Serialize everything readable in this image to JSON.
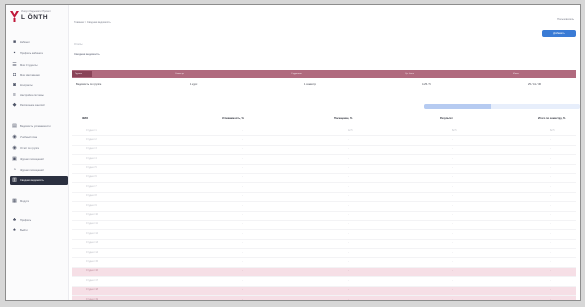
{
  "colors": {
    "accent": "#3a7bd5",
    "brand": "#c0183a",
    "summary_bar": "#b06a7e",
    "highlight_row": "#f6dfe6",
    "sidebar_active": "#2b3040"
  },
  "brand": {
    "subtitle": "Ушкул Хадымати Проект",
    "name": "L ÖNTH"
  },
  "sidebar": {
    "items": [
      {
        "icon": "home-icon",
        "label": "Кабинет"
      },
      {
        "icon": "chart-icon",
        "label": "Профиль кабинета"
      },
      {
        "icon": "users-icon",
        "label": "Мои Студенты"
      },
      {
        "icon": "doc-icon",
        "label": "Мои Наставники"
      },
      {
        "icon": "list-icon",
        "label": "Контракты"
      },
      {
        "icon": "settings-icon",
        "label": "Настройка системы"
      },
      {
        "icon": "calendar-icon",
        "label": "Расписание занятий"
      },
      {
        "icon": "book-icon",
        "label": "Ведомость успеваемости"
      },
      {
        "icon": "file-icon",
        "label": "Учебный план"
      },
      {
        "icon": "table-icon",
        "label": "Отчёт по группе"
      },
      {
        "icon": "clock-icon",
        "label": "Журнал посещений"
      },
      {
        "icon": "report-icon",
        "label": "Сводная ведомость"
      },
      {
        "icon": "grid-icon",
        "label": "Модули"
      },
      {
        "icon": "user-icon",
        "label": "Профиль"
      },
      {
        "icon": "logout-icon",
        "label": "Выйти"
      }
    ]
  },
  "header": {
    "breadcrumb": "Главная > Сводная ведомость",
    "user": "Пользователь",
    "primary_button": "Добавить"
  },
  "page": {
    "crumb": "Отчёты",
    "title": "Сводная ведомость"
  },
  "summary": {
    "headers": [
      "Группа",
      "Семестр",
      "Студентов",
      "Ср. балл",
      "Итого"
    ],
    "values": [
      "Ведомость по группе",
      "1 курс",
      "1 семестр",
      "4.25 / 5",
      "25 / 41 / 36"
    ]
  },
  "progress": {
    "percent": 43
  },
  "table": {
    "headers": [
      "ФИО",
      "Успеваемость, %",
      "Посещение, %",
      "Результат",
      "Итого по семестру, %"
    ],
    "rows": [
      {
        "cells": [
          "Студент 1",
          "-",
          "12.5",
          "62.5",
          "62.5"
        ],
        "highlight": false
      },
      {
        "cells": [
          "Студент 2",
          "-",
          "-",
          "-",
          "-"
        ],
        "highlight": false
      },
      {
        "cells": [
          "Студент 3",
          "-",
          "-",
          "-",
          "-"
        ],
        "highlight": false
      },
      {
        "cells": [
          "Студент 4",
          "-",
          "-",
          "-",
          "-"
        ],
        "highlight": false
      },
      {
        "cells": [
          "Студент 5",
          "-",
          "-",
          "-",
          "-"
        ],
        "highlight": false
      },
      {
        "cells": [
          "Студент 6",
          "-",
          "-",
          "-",
          "-"
        ],
        "highlight": false
      },
      {
        "cells": [
          "Студент 7",
          "-",
          "-",
          "-",
          "-"
        ],
        "highlight": false
      },
      {
        "cells": [
          "Студент 8",
          "-",
          "-",
          "-",
          "-"
        ],
        "highlight": false
      },
      {
        "cells": [
          "Студент 9",
          "-",
          "-",
          "-",
          "-"
        ],
        "highlight": false
      },
      {
        "cells": [
          "Студент 10",
          "-",
          "-",
          "-",
          "-"
        ],
        "highlight": false
      },
      {
        "cells": [
          "Студент 11",
          "-",
          "-",
          "-",
          "-"
        ],
        "highlight": false
      },
      {
        "cells": [
          "Студент 12",
          "-",
          "-",
          "-",
          "-"
        ],
        "highlight": false
      },
      {
        "cells": [
          "Студент 13",
          "-",
          "-",
          "-",
          "-"
        ],
        "highlight": false
      },
      {
        "cells": [
          "Студент 14",
          "-",
          "-",
          "-",
          "-"
        ],
        "highlight": false
      },
      {
        "cells": [
          "Студент 15",
          "-",
          "-",
          "-",
          "-"
        ],
        "highlight": false
      },
      {
        "cells": [
          "Студент 16",
          "-",
          "-",
          "-",
          "-"
        ],
        "highlight": true
      },
      {
        "cells": [
          "Студент 17",
          "-",
          "-",
          "-",
          "-"
        ],
        "highlight": false
      },
      {
        "cells": [
          "Студент 18",
          "-",
          "-",
          "-",
          "-"
        ],
        "highlight": true
      },
      {
        "cells": [
          "Студент 19",
          "-",
          "-",
          "-",
          "-"
        ],
        "highlight": true
      },
      {
        "cells": [
          "Студент 20",
          "-",
          "-",
          "-",
          "-"
        ],
        "highlight": false
      }
    ]
  }
}
